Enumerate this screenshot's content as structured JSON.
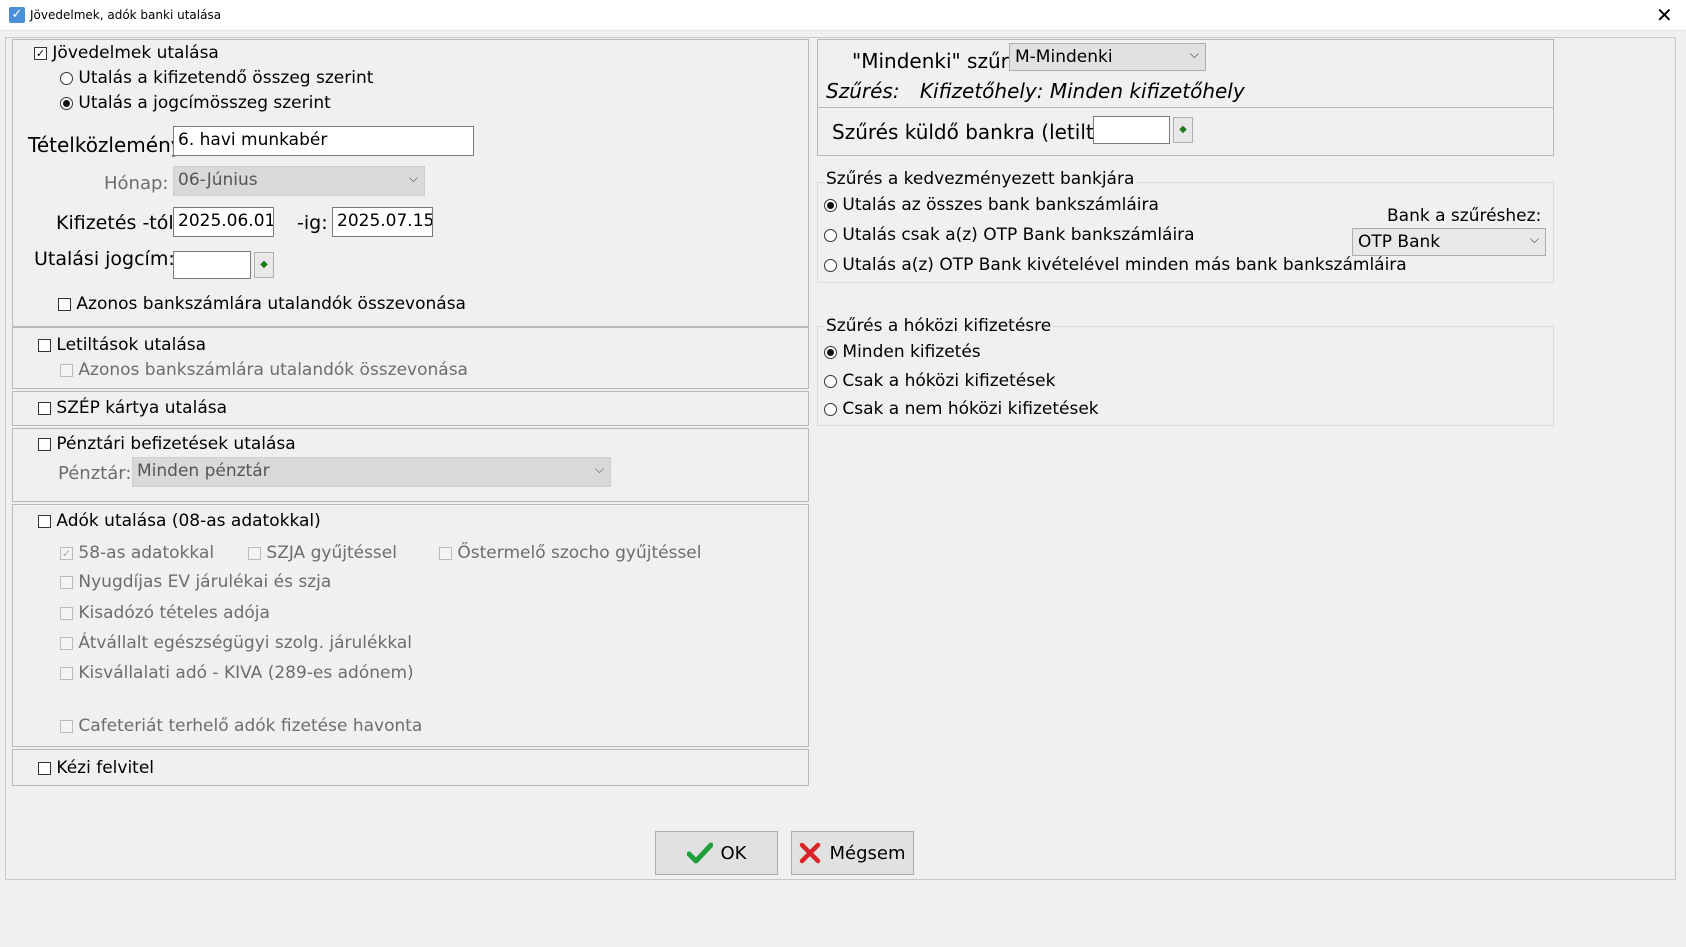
{
  "window": {
    "title": "Jövedelmek, adók banki utalása",
    "close_glyph": "✕"
  },
  "income": {
    "checkbox_label": "Jövedelmek utalása",
    "checked": true,
    "radio_1": "Utalás a kifizetendő összeg szerint",
    "radio_2": "Utalás a jogcímösszeg szerint",
    "selected_radio": 2,
    "memo_label": "Tételközlemény:",
    "memo_value": "6. havi munkabér",
    "month_label": "Hónap:",
    "month_value": "06-Június",
    "pay_from_label": "Kifizetés -tól:",
    "pay_from_value": "2025.06.01",
    "pay_to_label": "-ig:",
    "pay_to_value": "2025.07.15",
    "title_label": "Utalási jogcím:",
    "title_value": "",
    "merge_label": "Azonos bankszámlára utalandók összevonása"
  },
  "garnish": {
    "checkbox_label": "Letiltások utalása",
    "merge_label": "Azonos bankszámlára utalandók összevonása"
  },
  "szep": {
    "checkbox_label": "SZÉP kártya utalása"
  },
  "cash": {
    "checkbox_label": "Pénztári befizetések utalása",
    "register_label": "Pénztár:",
    "register_value": "Minden pénztár"
  },
  "taxes": {
    "checkbox_label": "Adók utalása (08-as adatokkal)",
    "opt_58": "58-as adatokkal",
    "opt_szja": "SZJA gyűjtéssel",
    "opt_ostermelo": "Őstermelő szocho gyűjtéssel",
    "opt_nyugdijas": "Nyugdíjas EV járulékai és szja",
    "opt_kisadozo": "Kisadózó tételes adója",
    "opt_atvallalt": "Átvállalt egészségügyi szolg. járulékkal",
    "opt_kiva": "Kisvállalati adó - KIVA (289-es adónem)",
    "opt_cafeteria": "Cafeteriát terhelő adók fizetése havonta"
  },
  "manual": {
    "checkbox_label": "Kézi felvitel"
  },
  "filter": {
    "mindenki_label": "\"Mindenki\" szűrés:",
    "mindenki_value": "M-Mindenki",
    "filter_prefix": "Szűrés:",
    "filter_text": "Kifizetőhely: Minden kifizetőhely",
    "sender_bank_label": "Szűrés küldő bankra (letiltás):",
    "sender_bank_value": ""
  },
  "beneficiary": {
    "group_title": "Szűrés a kedvezményezett bankjára",
    "radio_1": "Utalás az összes bank bankszámláira",
    "radio_2": "Utalás csak a(z) OTP Bank bankszámláira",
    "radio_3": "Utalás a(z) OTP Bank kivételével minden más bank bankszámláira",
    "bank_label": "Bank a szűréshez:",
    "bank_value": "OTP Bank"
  },
  "offcycle": {
    "group_title": "Szűrés a hóközi kifizetésre",
    "radio_1": "Minden kifizetés",
    "radio_2": "Csak a hóközi kifizetések",
    "radio_3": "Csak a nem hóközi kifizetések"
  },
  "buttons": {
    "ok": "OK",
    "cancel": "Mégsem"
  },
  "colors": {
    "ok_check": "#1f9e3a",
    "cancel_x": "#d9252a"
  }
}
